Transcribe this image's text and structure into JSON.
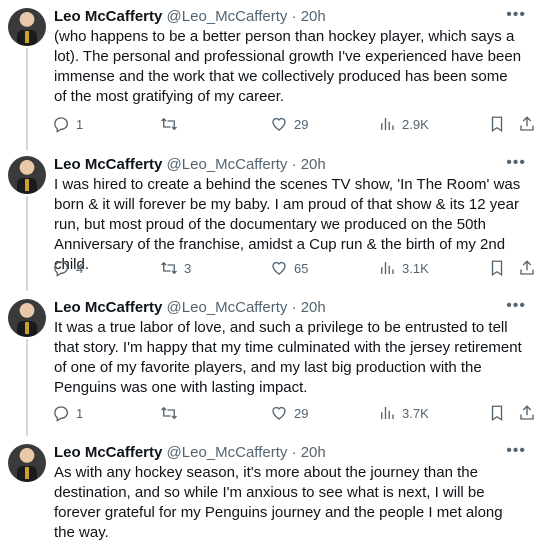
{
  "tweets": [
    {
      "name": "Leo McCafferty",
      "handle": "@Leo_McCafferty",
      "separator": "·",
      "time": "20h",
      "text": "(who happens to be a better person than hockey player, which says a lot). The personal and professional growth I've experienced have been immense and the work that we collectively produced has been some of the most gratifying of my career.",
      "replies": "1",
      "retweets": "",
      "likes": "29",
      "views": "2.9K"
    },
    {
      "name": "Leo McCafferty",
      "handle": "@Leo_McCafferty",
      "separator": "·",
      "time": "20h",
      "text": "I was hired to create a behind the scenes TV show, 'In The Room' was born & it will forever be my baby. I am proud of that show & its 12 year run, but most proud of the documentary we produced on the 50th Anniversary of the franchise, amidst a Cup run & the birth of my 2nd child.",
      "replies": "4",
      "retweets": "3",
      "likes": "65",
      "views": "3.1K"
    },
    {
      "name": "Leo McCafferty",
      "handle": "@Leo_McCafferty",
      "separator": "·",
      "time": "20h",
      "text": "It was a true labor of love, and such a privilege to be entrusted to tell that story. I'm happy that my time culminated with the jersey retirement of one of my favorite players, and my last big production with the Penguins was one with lasting impact.",
      "replies": "1",
      "retweets": "",
      "likes": "29",
      "views": "3.7K"
    },
    {
      "name": "Leo McCafferty",
      "handle": "@Leo_McCafferty",
      "separator": "·",
      "time": "20h",
      "text": "As with any hockey season, it's more about the journey than the destination, and so while I'm anxious to see what is next, I will be forever grateful for my Penguins journey and the people I met along the way."
    }
  ],
  "icons": {
    "more": "more-icon",
    "reply": "reply-icon",
    "retweet": "retweet-icon",
    "like": "heart-icon",
    "views": "views-icon",
    "bookmark": "bookmark-icon",
    "share": "share-icon"
  },
  "colors": {
    "text": "#0f1419",
    "secondary": "#536471",
    "thread_line": "#cfd9de"
  }
}
